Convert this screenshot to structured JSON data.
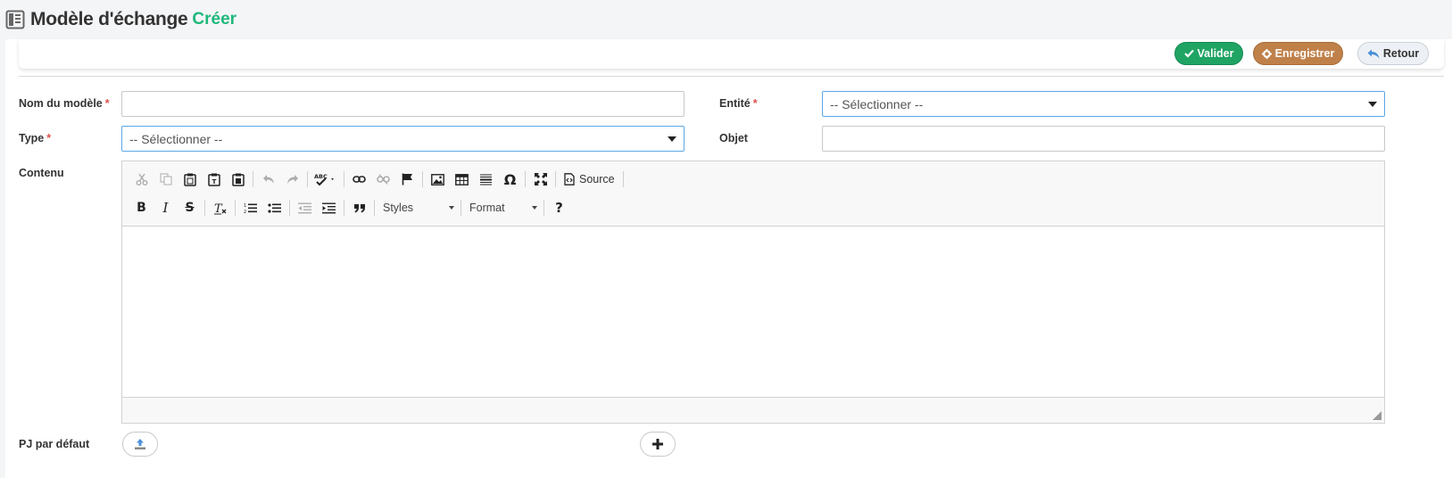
{
  "header": {
    "icon": "document-list-icon",
    "title": "Modèle d'échange",
    "subtitle": "Créer"
  },
  "actions": {
    "valider": "Valider",
    "enregistrer": "Enregistrer",
    "retour": "Retour"
  },
  "colors": {
    "accent_green": "#1fb87a",
    "valider_bg": "#1fa463",
    "enregistrer_bg": "#c0804a",
    "retour_bg": "#edf1f5",
    "required": "#d9534f",
    "select_border": "#5aa7e6"
  },
  "form": {
    "nom_label": "Nom du modèle",
    "nom_value": "",
    "entite_label": "Entité",
    "entite_value": "-- Sélectionner --",
    "type_label": "Type",
    "type_value": "-- Sélectionner --",
    "objet_label": "Objet",
    "objet_value": "",
    "contenu_label": "Contenu",
    "pj_label": "PJ par défaut",
    "required_mark": "*"
  },
  "editor": {
    "source_label": "Source",
    "styles_label": "Styles",
    "format_label": "Format",
    "content": ""
  }
}
